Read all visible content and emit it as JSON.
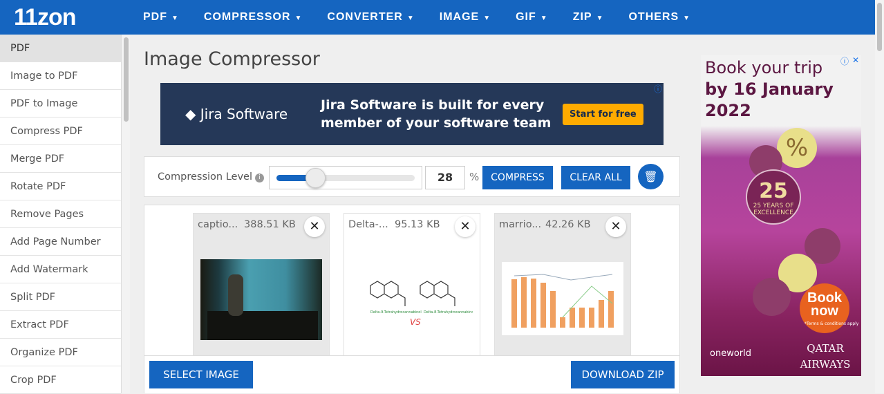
{
  "nav": {
    "logo": "11zon",
    "items": [
      "PDF",
      "COMPRESSOR",
      "CONVERTER",
      "IMAGE",
      "GIF",
      "ZIP",
      "OTHERS"
    ]
  },
  "sidebar": {
    "items": [
      "PDF",
      "Image to PDF",
      "PDF to Image",
      "Compress PDF",
      "Merge PDF",
      "Rotate PDF",
      "Remove Pages",
      "Add Page Number",
      "Add Watermark",
      "Split PDF",
      "Extract PDF",
      "Organize PDF",
      "Crop PDF"
    ],
    "active": 0
  },
  "page": {
    "title": "Image Compressor"
  },
  "jira_ad": {
    "brand": "Jira Software",
    "message": "Jira Software is built for every member of your software team",
    "cta": "Start for free"
  },
  "toolbar": {
    "label": "Compression Level",
    "value": "28",
    "level_percent": 28,
    "unit": "%",
    "compress": "COMPRESS",
    "clear_all": "CLEAR ALL"
  },
  "files": [
    {
      "name": "captio...",
      "size": "388.51 KB"
    },
    {
      "name": "Delta-...",
      "size": "95.13 KB"
    },
    {
      "name": "marrio...",
      "size": "42.26 KB"
    }
  ],
  "bottom": {
    "select": "SELECT IMAGE",
    "download": "DOWNLOAD ZIP"
  },
  "qatar_ad": {
    "line1": "Book your trip",
    "line2": "by 16 January",
    "line3": "2022",
    "cta": "Book now",
    "terms": "*Terms & conditions apply",
    "badge": "25 YEARS OF EXCELLENCE",
    "alliance": "oneworld",
    "brand": "QATAR AIRWAYS"
  },
  "colors": {
    "primary": "#1565c0",
    "jira_bg": "#253858",
    "jira_cta": "#ffab00",
    "qatar": "#5c1742"
  }
}
